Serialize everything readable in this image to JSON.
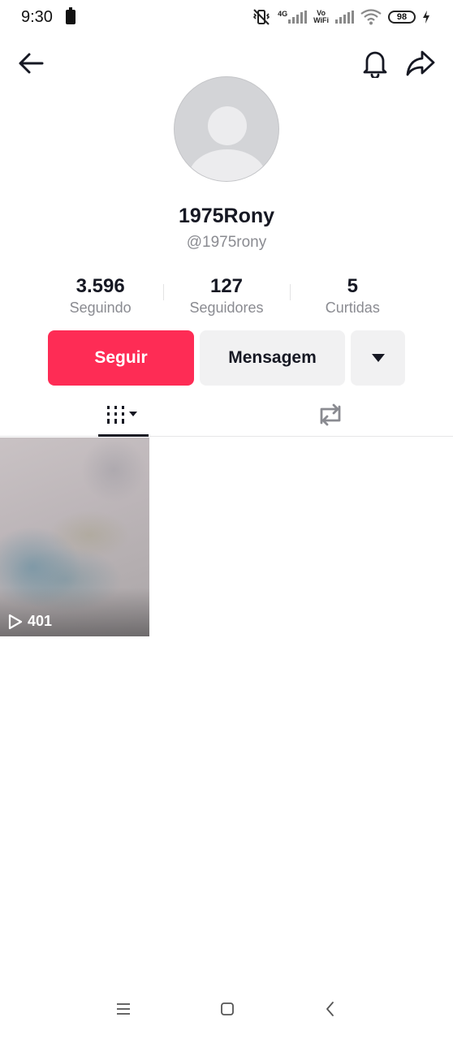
{
  "status_bar": {
    "time": "9:30",
    "network_label": "4G",
    "vowifi_label_top": "Vo",
    "vowifi_label_bottom": "WiFi",
    "battery": "98"
  },
  "profile": {
    "display_name": "1975Rony",
    "username": "@1975rony"
  },
  "stats": [
    {
      "value": "3.596",
      "label": "Seguindo"
    },
    {
      "value": "127",
      "label": "Seguidores"
    },
    {
      "value": "5",
      "label": "Curtidas"
    }
  ],
  "actions": {
    "follow_label": "Seguir",
    "message_label": "Mensagem"
  },
  "videos": [
    {
      "play_count": "401"
    }
  ],
  "colors": {
    "accent": "#fe2c55",
    "button_bg": "#f1f1f2",
    "text_primary": "#161823",
    "text_secondary": "#8a8b91"
  },
  "icons": [
    "back-arrow-icon",
    "bell-icon",
    "share-icon",
    "grid-icon",
    "repost-icon",
    "play-icon"
  ]
}
